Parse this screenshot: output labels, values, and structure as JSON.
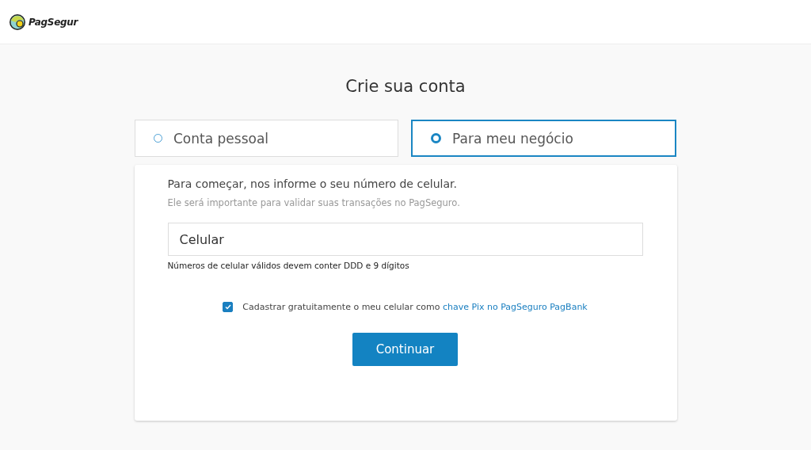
{
  "header": {
    "logo_text": "PagSegur"
  },
  "title": "Crie sua conta",
  "account_types": [
    {
      "label": "Conta pessoal",
      "selected": false
    },
    {
      "label": "Para meu negócio",
      "selected": true
    }
  ],
  "form": {
    "intro": "Para começar, nos informe o seu número de celular.",
    "subtitle": "Ele será importante para validar suas transações no PagSeguro.",
    "phone_field": {
      "placeholder": "Celular"
    },
    "hint": "Números de celular válidos devem conter DDD e 9 dígitos",
    "pix_consent": {
      "checked": true,
      "text": "Cadastrar gratuitamente o meu celular como",
      "link": "chave Pix no PagSeguro PagBank"
    },
    "submit": "Continuar"
  }
}
